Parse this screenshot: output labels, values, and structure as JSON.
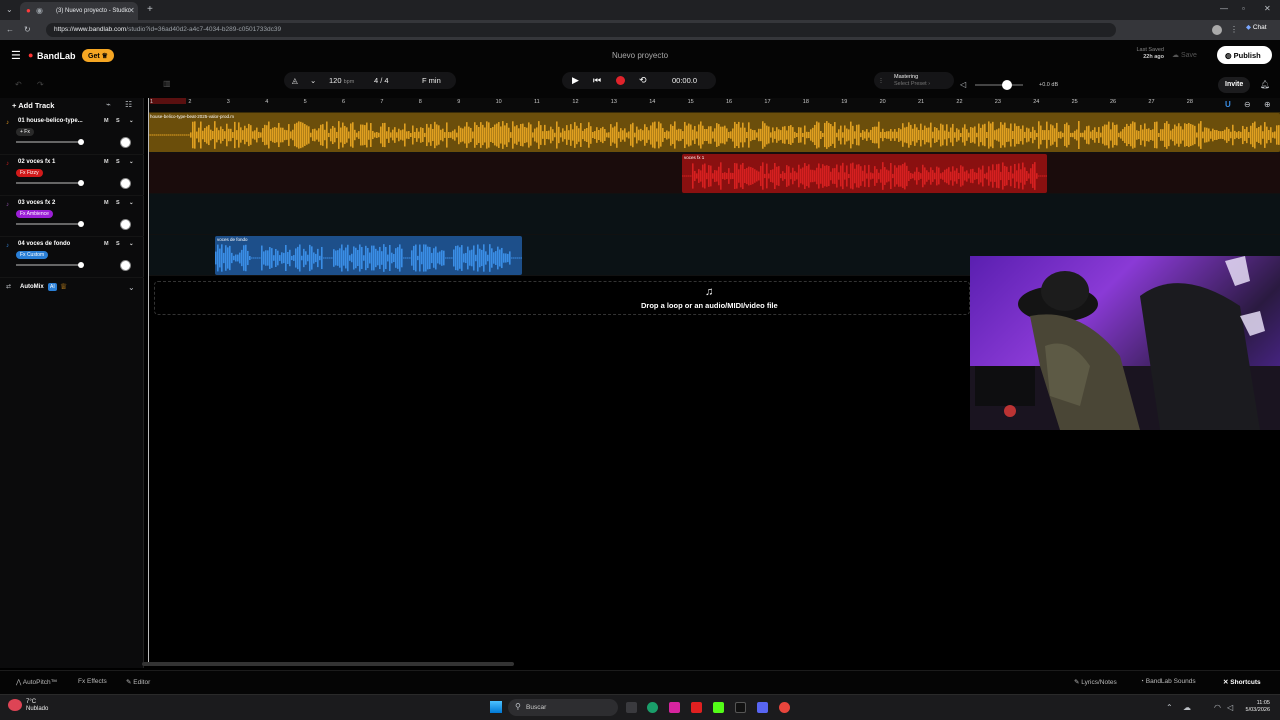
{
  "browser": {
    "tab_title": "(3) Nuevo proyecto - Studio",
    "url_host": "https://www.bandlab.com",
    "url_path": "/studio?id=36ad40d2-a4c7-4034-b289-c0501733dc39",
    "chat_label": "Chat"
  },
  "topbar": {
    "logo": "BandLab",
    "get_label": "Get",
    "project_title": "Nuevo proyecto",
    "last_saved_label": "Last Saved",
    "last_saved_value": "22h ago",
    "save_label": "Save",
    "publish_label": "Publish"
  },
  "transport": {
    "bpm_value": "120",
    "bpm_unit": "bpm",
    "time_signature": "4 / 4",
    "key": "F min",
    "time": "00:00.0",
    "mastering_label": "Mastering",
    "mastering_preset": "Select Preset ›",
    "master_db": "+0.0 dB",
    "invite_label": "Invite"
  },
  "leftpanel": {
    "add_track_label": "Add Track",
    "automix_label": "AutoMix",
    "automix_badge": "AI"
  },
  "tracks": [
    {
      "name": "01  house-belico-type...",
      "badge": "+ Fx",
      "badge_color": "#2a2a2a",
      "color": "#f5a623"
    },
    {
      "name": "02  voces fx 1",
      "badge": "Fx Fizzy",
      "badge_color": "#d11a1a",
      "color": "#e02020"
    },
    {
      "name": "03  voces fx 2",
      "badge": "Fx Ambience",
      "badge_color": "#9b1fd6",
      "color": "#9b59b6"
    },
    {
      "name": "04  voces de fondo",
      "badge": "Fx Custom",
      "badge_color": "#2a7fd6",
      "color": "#3a8fe8"
    }
  ],
  "ms_labels": {
    "m": "M",
    "s": "S"
  },
  "ruler": [
    "1",
    "2",
    "3",
    "4",
    "5",
    "6",
    "7",
    "8",
    "9",
    "10",
    "11",
    "12",
    "13",
    "14",
    "15",
    "16",
    "17",
    "18",
    "19",
    "20",
    "21",
    "22",
    "23",
    "24",
    "25",
    "26",
    "27",
    "28"
  ],
  "clips": [
    {
      "label": "house-belico-type-beat-2025-valor-prod.m",
      "color": "#e0a020"
    },
    {
      "label": "voces fx 1",
      "color": "#d62020"
    },
    {
      "label": "voces de fondo",
      "color": "#3a8ee6"
    }
  ],
  "dropzone": {
    "text": "Drop a loop or an audio/MIDI/video file"
  },
  "bottombar": {
    "autopitch": "AutoPitch™",
    "effects": "Effects",
    "editor": "Editor",
    "lyrics": "Lyrics/Notes",
    "sounds": "BandLab Sounds",
    "shortcuts": "Shortcuts"
  },
  "taskbar": {
    "weather_temp": "7°C",
    "weather_desc": "Nublado",
    "search_placeholder": "Buscar",
    "clock_time": "11:05",
    "clock_date": "5/03/2026"
  }
}
